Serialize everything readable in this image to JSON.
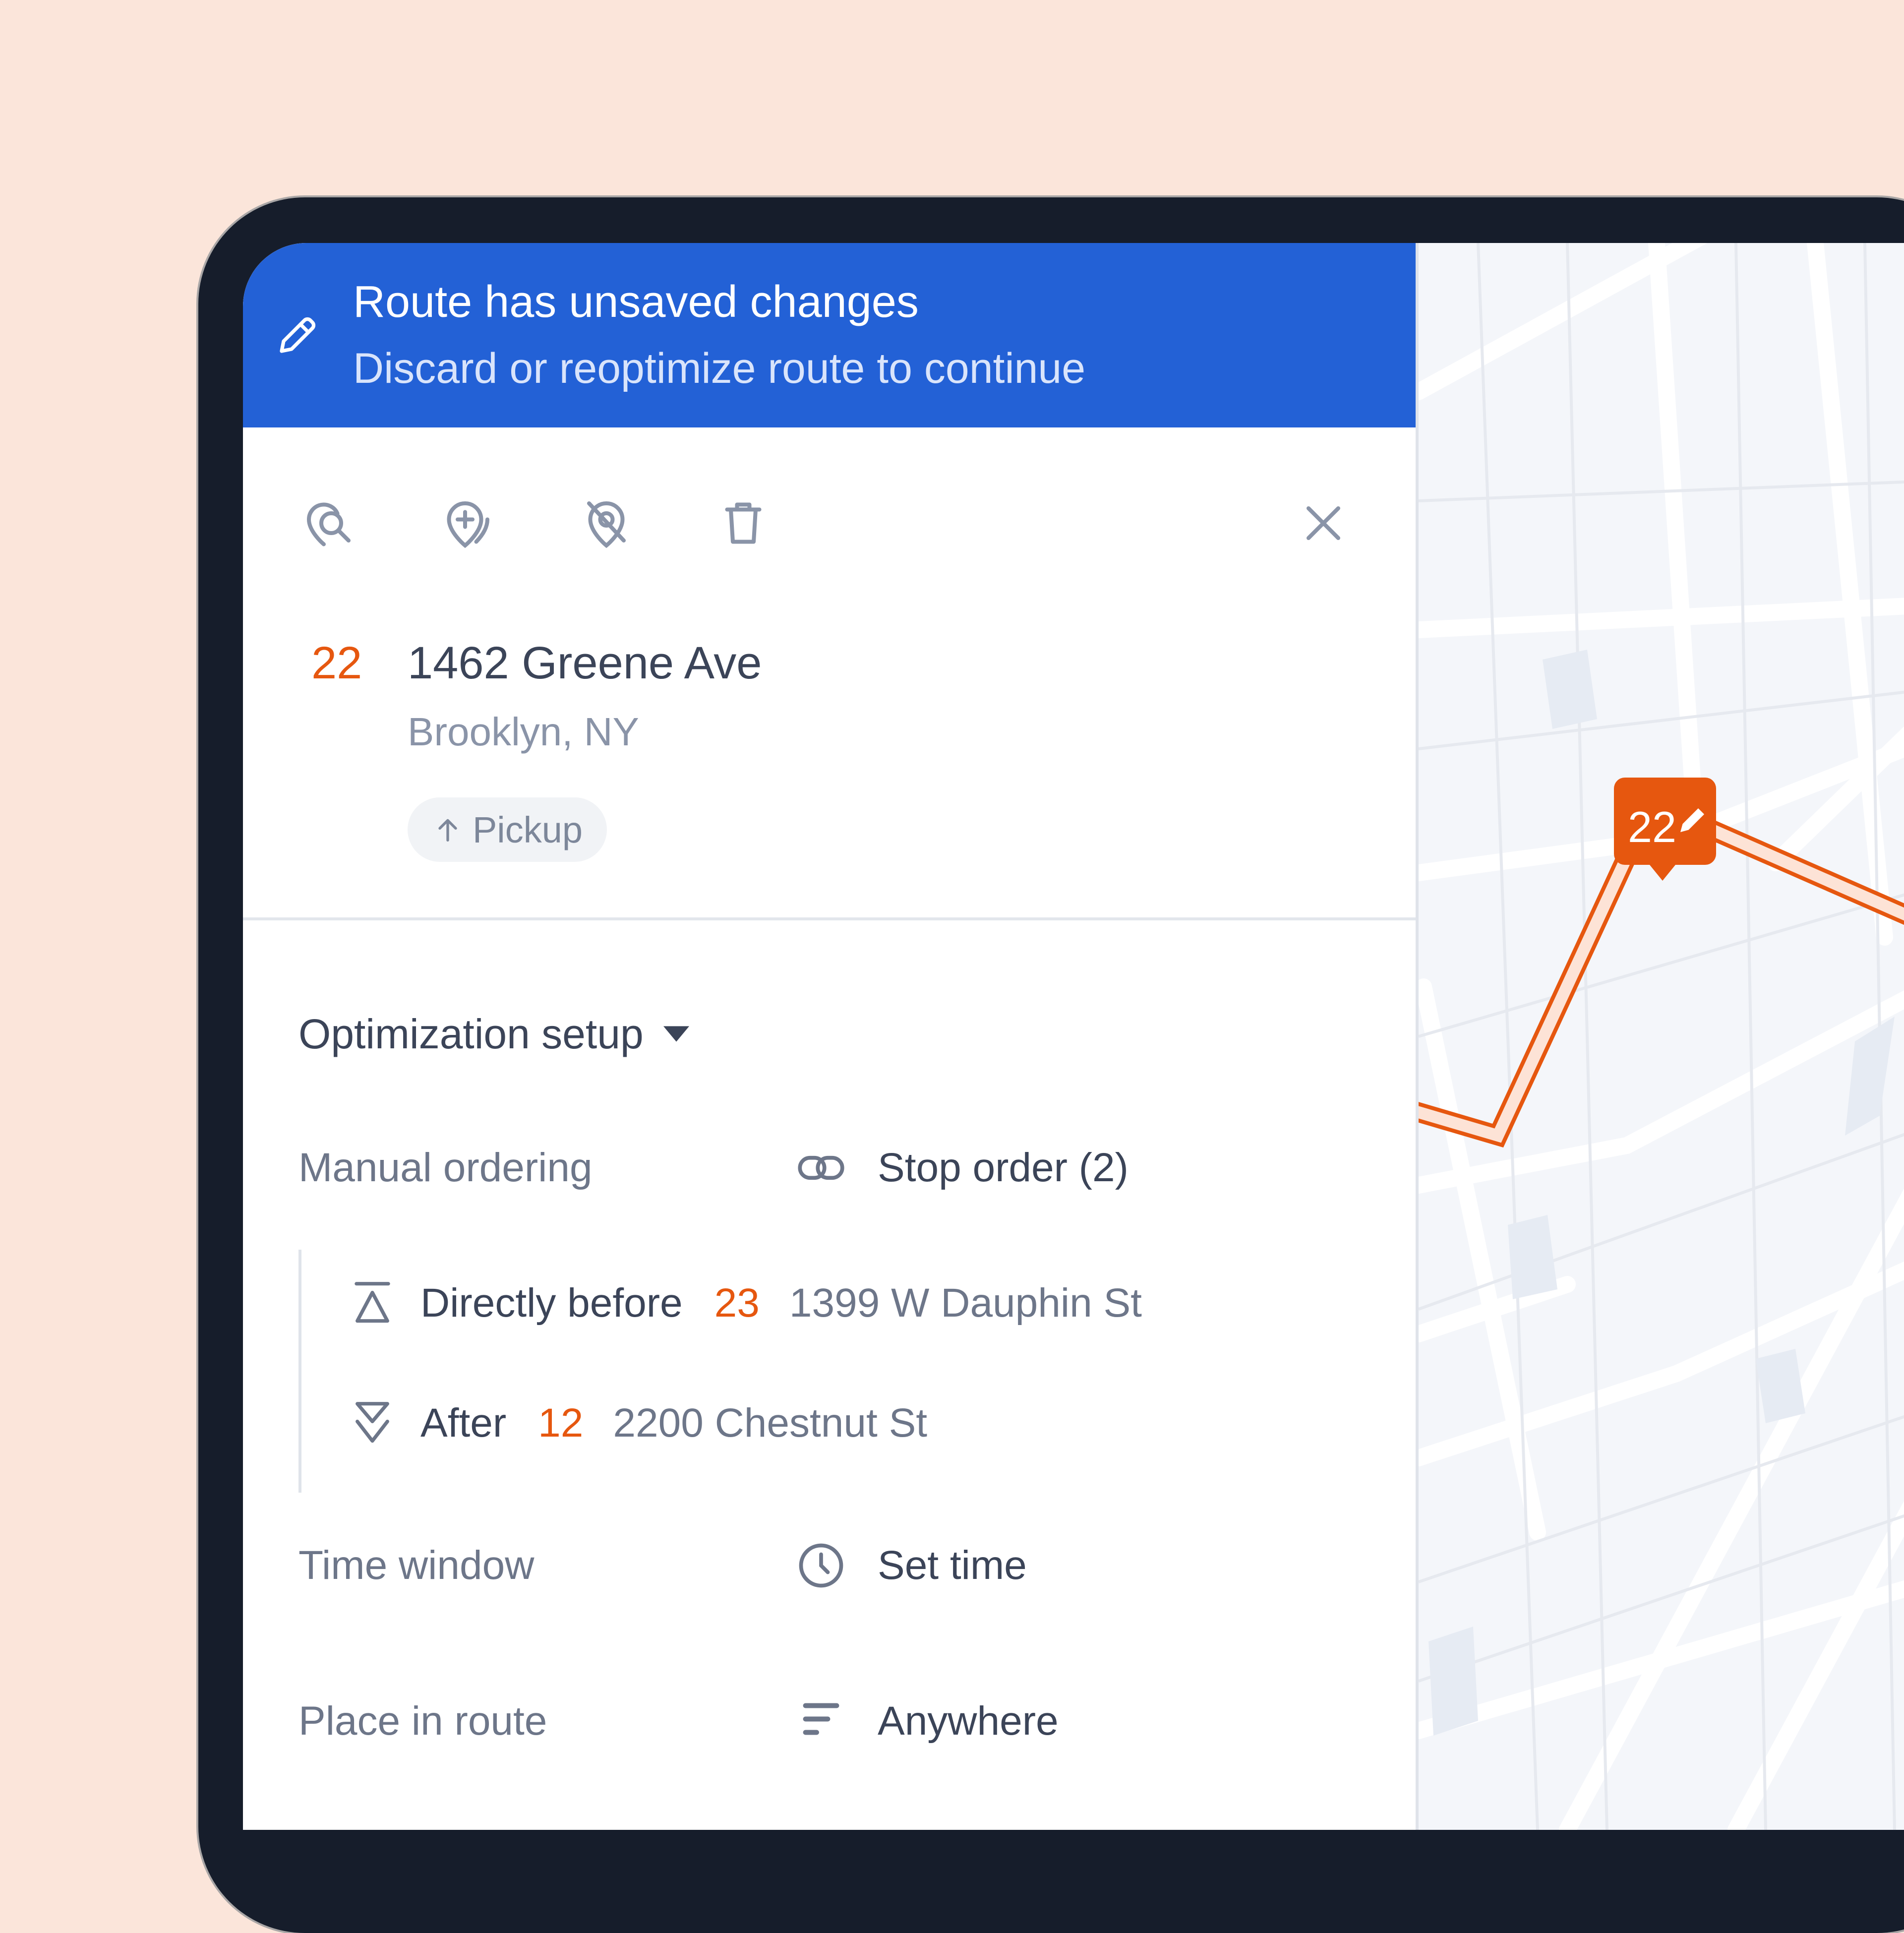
{
  "banner": {
    "title": "Route has unsaved changes",
    "subtitle": "Discard or reoptimize route to continue"
  },
  "toolbar": {
    "icons": [
      "search-map-pin-icon",
      "add-map-pin-icon",
      "hide-map-pin-icon",
      "trash-icon",
      "close-icon"
    ]
  },
  "stop": {
    "number": "22",
    "address": "1462 Greene Ave",
    "city": "Brooklyn, NY",
    "type_badge": "Pickup"
  },
  "optimization": {
    "section_title": "Optimization setup",
    "manual_ordering": {
      "label": "Manual ordering",
      "value": "Stop order (2)",
      "entries": [
        {
          "relation": "Directly before",
          "stop_number": "23",
          "address": "1399 W Dauphin St"
        },
        {
          "relation": "After",
          "stop_number": "12",
          "address": "2200 Chestnut St"
        }
      ]
    },
    "time_window": {
      "label": "Time window",
      "value": "Set time"
    },
    "place_in_route": {
      "label": "Place in route",
      "value": "Anywhere"
    }
  },
  "map": {
    "marker_number": "22",
    "route_color": "#e6570f",
    "route_fill": "#fde3d6"
  },
  "colors": {
    "accent": "#2361d6",
    "stop_number": "#e6570f",
    "background": "#fbe5da"
  }
}
